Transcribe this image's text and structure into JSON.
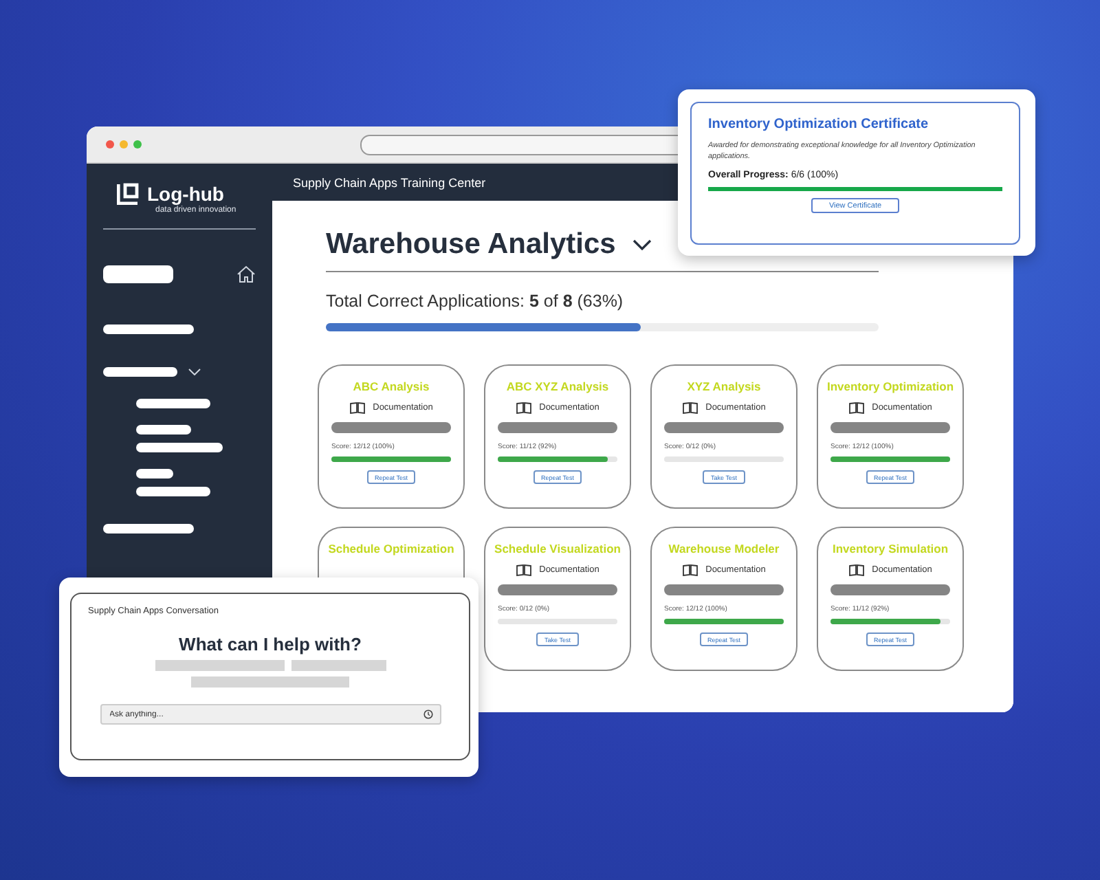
{
  "browser": {
    "sidebar": {
      "logo": "Log-hub",
      "tagline": "data driven innovation"
    },
    "header": {
      "title": "Supply Chain Apps Training Center"
    },
    "page": {
      "title": "Warehouse Analytics",
      "summary": "Total Correct Applications: **5** of **8** (63%)",
      "level": 0.57,
      "cards": [
        {
          "title": "ABC Analysis",
          "link": "Documentation",
          "score": "Score: 12/12 (100%)",
          "level": 1,
          "button": "Repeat Test"
        },
        {
          "title": "ABC XYZ Analysis",
          "link": "Documentation",
          "score": "Score: 11/12 (92%)",
          "level": 0.92,
          "button": "Repeat Test"
        },
        {
          "title": "XYZ Analysis",
          "link": "Documentation",
          "score": "Score: 0/12 (0%)",
          "level": 0,
          "button": "Take Test"
        },
        {
          "title": "Inventory Optimization",
          "link": "Documentation",
          "score": "Score: 12/12 (100%)",
          "level": 1,
          "button": "Repeat Test"
        },
        {
          "title": "Schedule Optimization"
        },
        {
          "title": "Schedule Visualization",
          "link": "Documentation",
          "score": "Score: 0/12 (0%)",
          "level": 0,
          "button": "Take Test"
        },
        {
          "title": "Warehouse Modeler",
          "link": "Documentation",
          "score": "Score: 12/12 (100%)",
          "level": 1,
          "button": "Repeat Test"
        },
        {
          "title": "Inventory Simulation",
          "link": "Documentation",
          "score": "Score: 11/12 (92%)",
          "level": 0.92,
          "button": "Repeat Test"
        }
      ]
    }
  },
  "certificate": {
    "title": "Inventory Optimization Certificate",
    "description": "Awarded for demonstrating exceptional knowledge for all Inventory Optimization applications.",
    "progress": "**Overall Progress:** 6/6 (100%)",
    "level": 1,
    "button": "View Certificate"
  },
  "chat": {
    "title": "Supply Chain Apps Conversation",
    "heading": "What can I help with?",
    "placeholder": "Ask anything..."
  }
}
